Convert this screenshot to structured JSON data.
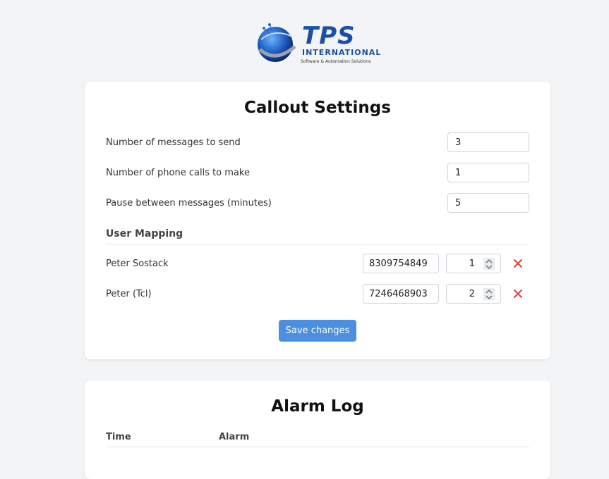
{
  "logo": {
    "name": "TPS",
    "subtitle": "INTERNATIONAL",
    "tagline": "Software & Automation Solutions"
  },
  "settings": {
    "title": "Callout Settings",
    "fields": [
      {
        "label": "Number of messages to send",
        "value": "3"
      },
      {
        "label": "Number of phone calls to make",
        "value": "1"
      },
      {
        "label": "Pause between messages (minutes)",
        "value": "5"
      }
    ],
    "user_mapping": {
      "heading": "User Mapping",
      "users": [
        {
          "name": "Peter Sostack",
          "phone": "8309754849",
          "order": "1"
        },
        {
          "name": "Peter (Tcl)",
          "phone": "7246468903",
          "order": "2"
        }
      ]
    },
    "save_label": "Save changes"
  },
  "alarm_log": {
    "title": "Alarm Log",
    "columns": [
      "Time",
      "Alarm"
    ]
  },
  "colors": {
    "primary": "#4a8fe0",
    "remove": "#d9433c",
    "background": "#f3f4f6"
  },
  "icons": {
    "remove": "close-icon",
    "spinner": "chevron-up-down-icon"
  }
}
